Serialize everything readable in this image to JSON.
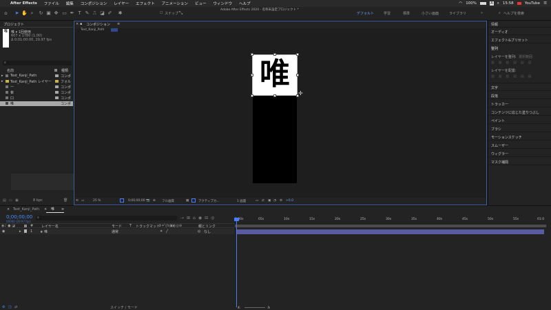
{
  "menubar": {
    "app": "After Effects",
    "items": [
      "ファイル",
      "編集",
      "コンポジション",
      "レイヤー",
      "エフェクト",
      "アニメーション",
      "ビュー",
      "ウィンドウ",
      "ヘルプ"
    ],
    "battery": "100%",
    "clock": "15:58",
    "youtube": "YouTube"
  },
  "toolbar": {
    "title": "Adobe After Effects 2020 - 名称未設定プロジェクト *",
    "snap_label": "スナップ",
    "workspaces": [
      "デフォルト",
      "学習",
      "標準",
      "小さい画面",
      "ライブラリ"
    ],
    "help_placeholder": "ヘルプを検索"
  },
  "project": {
    "title": "プロジェクト",
    "item_name": "唯 ▾ 1回使用",
    "item_size": "607 x 1780 (1.00)",
    "item_duration": "Δ 0:01:00:00, 29.97 fps",
    "col_name": "名前",
    "col_type": "種類",
    "items": [
      {
        "name": "Text_Kanji_Path",
        "type": "コンポ",
        "color": "#a8a8a8"
      },
      {
        "name": "Text_Kanji_Path レイヤー",
        "type": "フォル",
        "color": "#c8b44a"
      },
      {
        "name": "一",
        "type": "コンポ",
        "color": "#a8a8a8"
      },
      {
        "name": "隹",
        "type": "コンポ",
        "color": "#a8a8a8"
      },
      {
        "name": "口",
        "type": "コンポ",
        "color": "#a8a8a8"
      },
      {
        "name": "唯",
        "type": "コンポ",
        "color": "#a8a8a8"
      }
    ],
    "bpc": "8 bpc"
  },
  "composition": {
    "panel_title": "コンポジション",
    "comp_tab": "Text_Kanji_Path",
    "glyph": "唯",
    "zoom": "25 %",
    "timecode": "0;00;00;00",
    "quality": "フル画質",
    "camera": "アクティブカ...",
    "views": "1 画面",
    "exposure": "+0.0"
  },
  "right_panel": {
    "items": [
      "情報",
      "オーディオ",
      "エフェクト&プリセット",
      "整列",
      "レイヤーを整列:",
      "レイヤーを配置:",
      "文字",
      "段落",
      "トラッカー",
      "コンテンツに応じた塗りつぶし",
      "ペイント",
      "ブラシ",
      "モーションスケッチ",
      "スムーザー",
      "ウィグラー",
      "マスク補間"
    ],
    "align_target": "選択範囲"
  },
  "timeline": {
    "tab1": "Text_Kanji_Path",
    "tab2": "唯",
    "timecode": "0;00;00;00",
    "fps_info": "00000 (29.97 fps)",
    "col_layer_name": "レイヤー名",
    "col_mode": "モード",
    "col_t": "T",
    "col_trkmat": "トラックマット",
    "col_parent": "親とリンク",
    "layer_index": "1",
    "layer_name": "★ 唯",
    "layer_mode": "通常",
    "layer_parent": "なし",
    "ruler": [
      "0:00s",
      "05s",
      "10s",
      "15s",
      "20s",
      "25s",
      "30s",
      "35s",
      "40s",
      "45s",
      "50s",
      "55s",
      "01:0"
    ],
    "footer_label": "スイッチ / モード"
  }
}
